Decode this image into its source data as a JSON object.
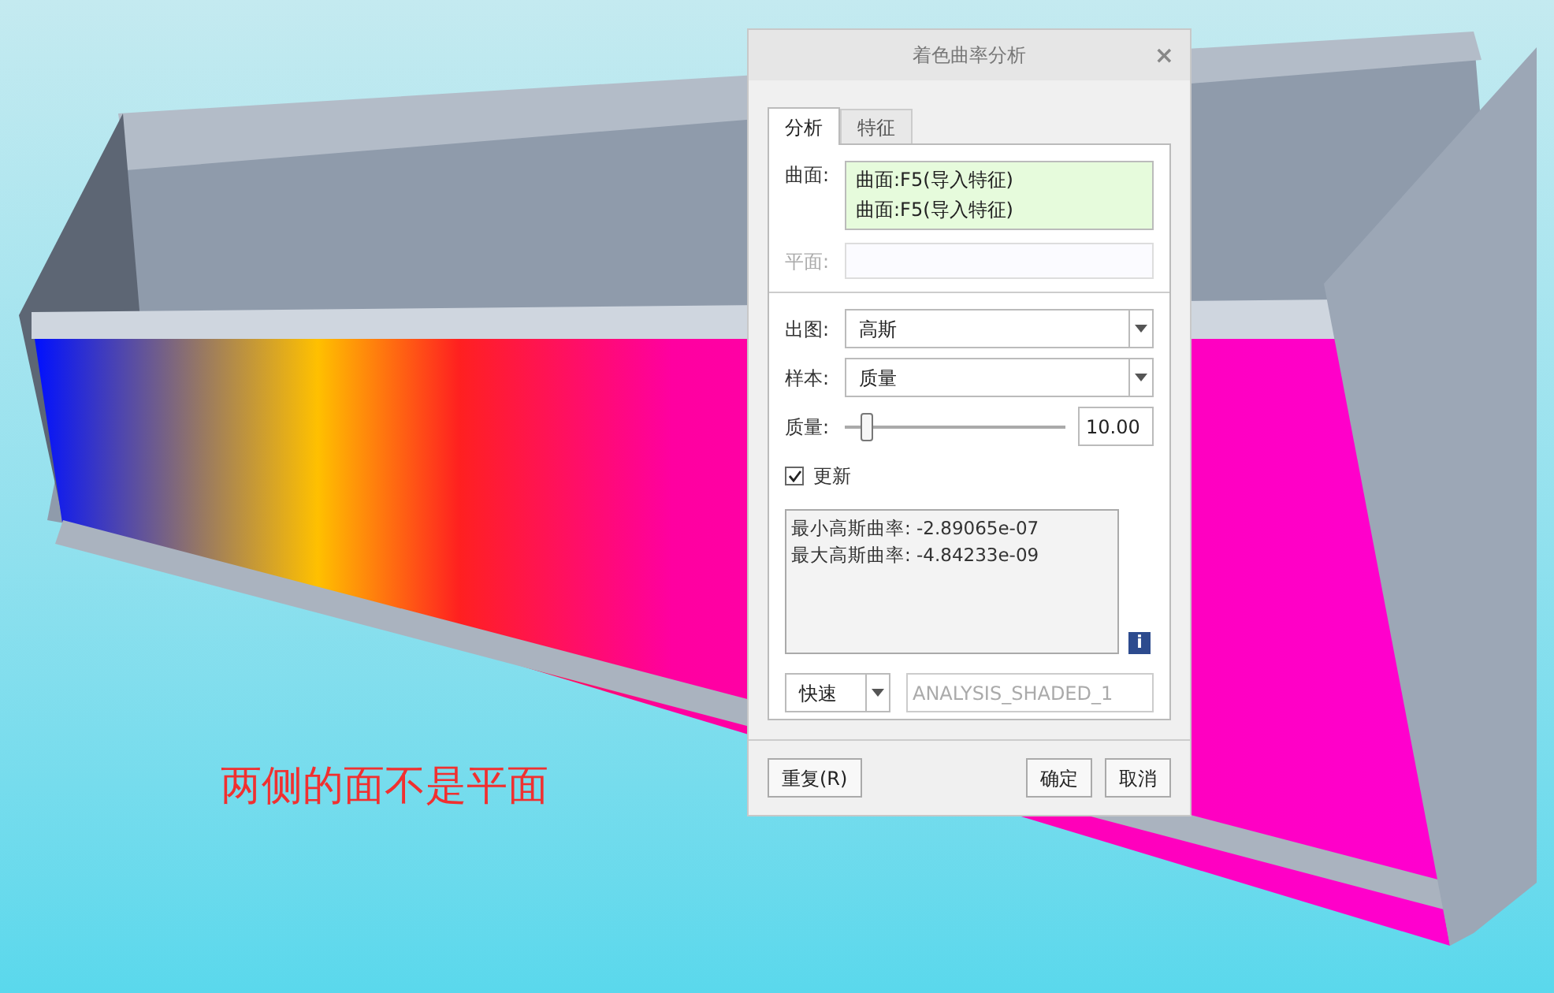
{
  "annotation": "两侧的面不是平面",
  "dialog": {
    "title": "着色曲率分析",
    "close": "×",
    "tabs": [
      {
        "label": "分析",
        "selected": true
      },
      {
        "label": "特征",
        "selected": false
      }
    ],
    "surface": {
      "label": "曲面:",
      "items": [
        "曲面:F5(导入特征)",
        "曲面:F5(导入特征)"
      ]
    },
    "plane": {
      "label": "平面:",
      "disabled": true
    },
    "output": {
      "label": "出图:",
      "value": "高斯"
    },
    "sample": {
      "label": "样本:",
      "value": "质量"
    },
    "quality": {
      "label": "质量:",
      "level": 0.1,
      "value": "10.00"
    },
    "update": {
      "label": "更新",
      "checked": true
    },
    "results": [
      "最小高斯曲率: -2.89065e-07",
      "最大高斯曲率: -4.84233e-09"
    ],
    "info": "i",
    "mode": {
      "value": "快速"
    },
    "name": {
      "placeholder": "ANALYSIS_SHADED_1"
    },
    "buttons": {
      "repeat": "重复(R)",
      "ok": "确定",
      "cancel": "取消"
    }
  }
}
